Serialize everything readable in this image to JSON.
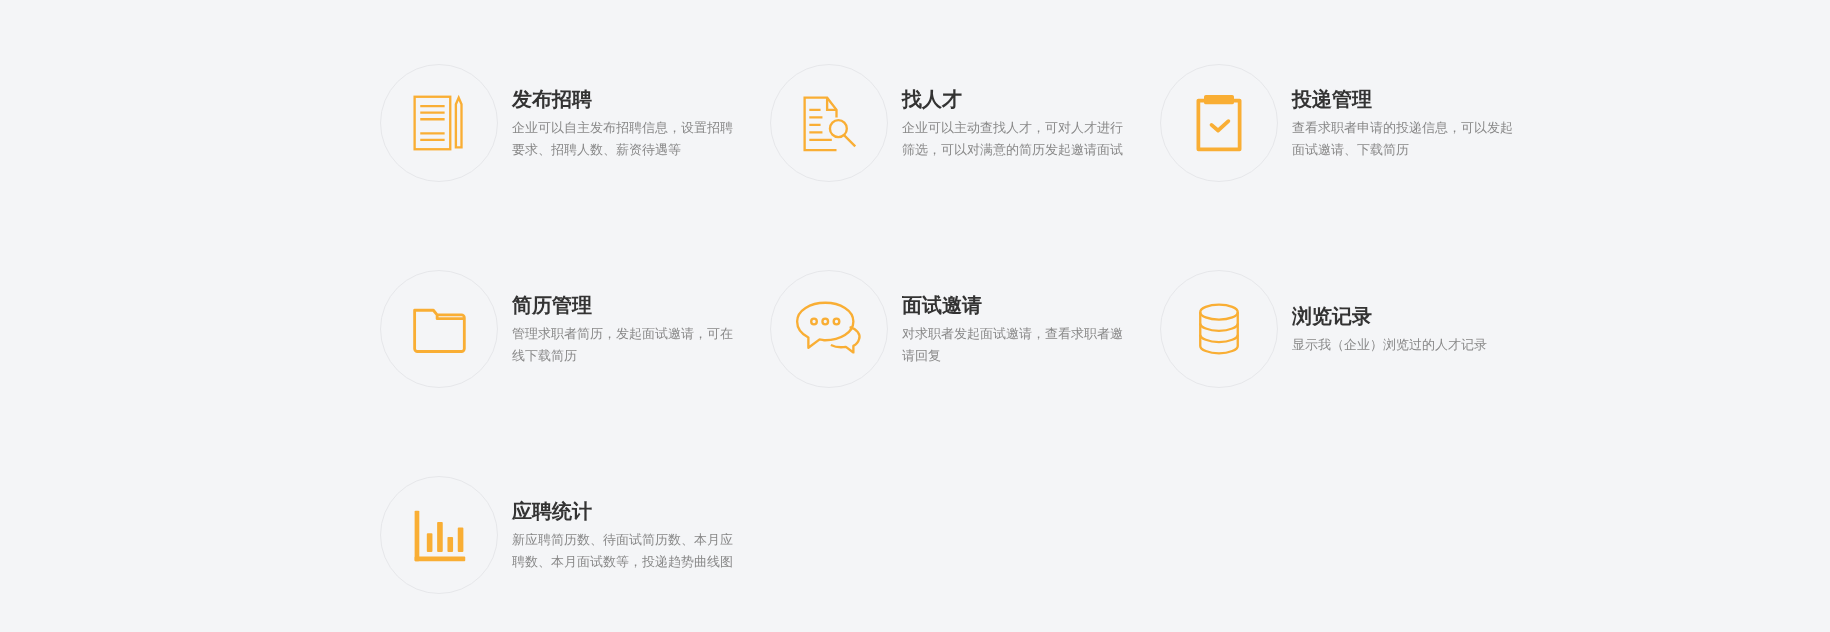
{
  "features": [
    {
      "title": "发布招聘",
      "description": "企业可以自主发布招聘信息，设置招聘要求、招聘人数、薪资待遇等"
    },
    {
      "title": "找人才",
      "description": "企业可以主动查找人才，可对人才进行筛选，可以对满意的简历发起邀请面试"
    },
    {
      "title": "投递管理",
      "description": "查看求职者申请的投递信息，可以发起面试邀请、下载简历"
    },
    {
      "title": "简历管理",
      "description": "管理求职者简历，发起面试邀请，可在线下载简历"
    },
    {
      "title": "面试邀请",
      "description": "对求职者发起面试邀请，查看求职者邀请回复"
    },
    {
      "title": "浏览记录",
      "description": "显示我（企业）浏览过的人才记录"
    },
    {
      "title": "应聘统计",
      "description": "新应聘简历数、待面试简历数、本月应聘数、本月面试数等，投递趋势曲线图"
    }
  ]
}
